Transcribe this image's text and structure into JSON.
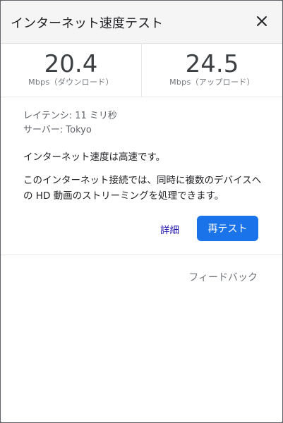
{
  "dialog": {
    "title": "インターネット速度テスト",
    "close_icon": "close-icon"
  },
  "download": {
    "value": "20.4",
    "label": "Mbps（ダウンロード）"
  },
  "upload": {
    "value": "24.5",
    "label": "Mbps（アップロード）"
  },
  "details": {
    "latency": "レイテンシ: 11 ミリ秒",
    "server": "サーバー: Tokyo"
  },
  "result": {
    "status": "インターネット速度は高速です。",
    "description": "このインターネット接続では、同時に複数のデバイスへの HD 動画のストリーミングを処理できます。"
  },
  "actions": {
    "details_label": "詳細",
    "retest_label": "再テスト",
    "feedback_label": "フィードバック"
  },
  "colors": {
    "accent": "#1a73e8",
    "link": "#1a0dab"
  }
}
